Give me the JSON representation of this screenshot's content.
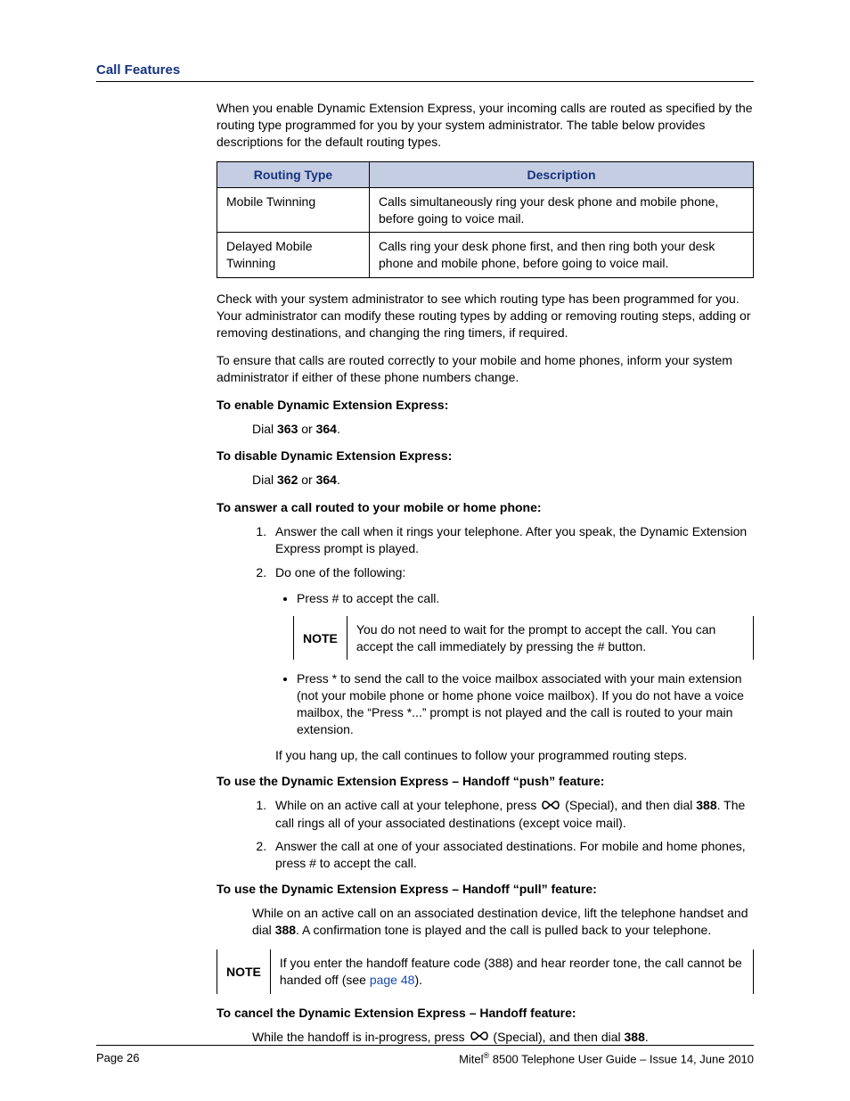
{
  "header": {
    "title": "Call Features"
  },
  "intro": "When you enable Dynamic Extension Express, your incoming calls are routed as specified by the routing type programmed for you by your system administrator. The table below provides descriptions for the default routing types.",
  "table": {
    "col1_header": "Routing Type",
    "col2_header": "Description",
    "rows": [
      {
        "type": "Mobile Twinning",
        "desc": "Calls simultaneously ring your desk phone and mobile phone, before going to voice mail."
      },
      {
        "type": "Delayed Mobile Twinning",
        "desc": "Calls ring your desk phone first, and then ring both your desk phone and mobile phone, before going to voice mail."
      }
    ]
  },
  "para_check": "Check with your system administrator to see which routing type has been programmed for you. Your administrator can modify these routing types by adding or removing routing steps, adding or removing destinations, and changing the ring timers, if required.",
  "para_ensure": "To ensure that calls are routed correctly to your mobile and home phones, inform your system administrator if either of these phone numbers change.",
  "enable": {
    "heading": "To enable Dynamic Extension Express:",
    "pre": "Dial ",
    "code1": "363",
    "mid": " or ",
    "code2": "364",
    "post": "."
  },
  "disable": {
    "heading": "To disable Dynamic Extension Express:",
    "pre": "Dial ",
    "code1": "362",
    "mid": " or ",
    "code2": "364",
    "post": "."
  },
  "answer": {
    "heading": "To answer a call routed to your mobile or home phone:",
    "step1": "Answer the call when it rings your telephone. After you speak, the Dynamic Extension Express prompt is played.",
    "step2": "Do one of the following:",
    "bullet1": "Press # to accept the call.",
    "note_label": "NOTE",
    "note_text": "You do not need to wait for the prompt to accept the call. You can accept the call immediately by pressing the # button.",
    "bullet2": "Press * to send the call to the voice mailbox associated with your main extension (not your mobile phone or home phone voice mailbox). If you do not have a voice mailbox, the “Press *...” prompt is not played and the call is routed to your main extension.",
    "hangup": "If you hang up, the call continues to follow your programmed routing steps."
  },
  "push": {
    "heading": "To use the Dynamic Extension Express – Handoff “push” feature:",
    "step1_a": "While on an active call at your telephone, press ",
    "step1_b": " (Special), and then dial ",
    "step1_code": "388",
    "step1_c": ". The call rings all of your associated destinations (except voice mail).",
    "step2": "Answer the call at one of your associated destinations. For mobile and home phones, press # to accept the call."
  },
  "pull": {
    "heading": "To use the Dynamic Extension Express – Handoff “pull” feature:",
    "text_a": "While on an active call on an associated destination device, lift the telephone handset and dial ",
    "text_code": "388",
    "text_b": ". A confirmation tone is played and the call is pulled back to your telephone."
  },
  "note2": {
    "label": "NOTE",
    "text_a": "If you enter the handoff feature code (388) and hear reorder tone, the call cannot be handed off (see ",
    "link": "page 48",
    "text_b": ")."
  },
  "cancel": {
    "heading": "To cancel the Dynamic Extension Express – Handoff feature:",
    "text_a": "While the handoff is in-progress, press ",
    "text_b": " (Special), and then dial ",
    "text_code": "388",
    "text_c": "."
  },
  "footer": {
    "left": "Page 26",
    "right_a": "Mitel",
    "right_b": " 8500 Telephone User Guide – Issue 14, June 2010",
    "reg": "®"
  }
}
